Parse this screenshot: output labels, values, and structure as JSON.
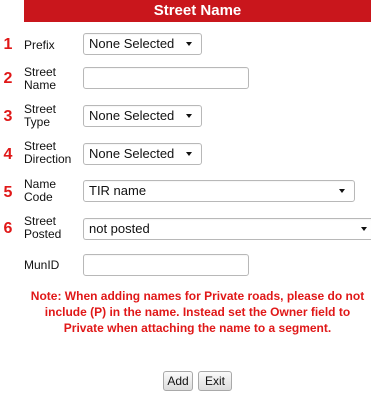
{
  "form": {
    "title": "Street Name",
    "markers": [
      "1",
      "2",
      "3",
      "4",
      "5",
      "6"
    ],
    "fields": {
      "prefix": {
        "label": "Prefix",
        "value": "None Selected"
      },
      "street_name": {
        "label": "Street Name",
        "value": ""
      },
      "street_type": {
        "label": "Street Type",
        "value": "None Selected"
      },
      "street_direction": {
        "label": "Street Direction",
        "value": "None Selected"
      },
      "name_code": {
        "label": "Name Code",
        "value": "TIR name"
      },
      "street_posted": {
        "label": "Street Posted",
        "value": "not posted"
      },
      "munid": {
        "label": "MunID",
        "value": ""
      }
    },
    "note": "Note: When adding names for Private roads, please do not include (P) in the name. Instead set the Owner field to Private when attaching the name to a segment.",
    "buttons": {
      "add": "Add",
      "exit": "Exit"
    }
  },
  "colors": {
    "header_bg": "#c9161c",
    "marker": "#e01818",
    "note_text": "#e01818"
  }
}
